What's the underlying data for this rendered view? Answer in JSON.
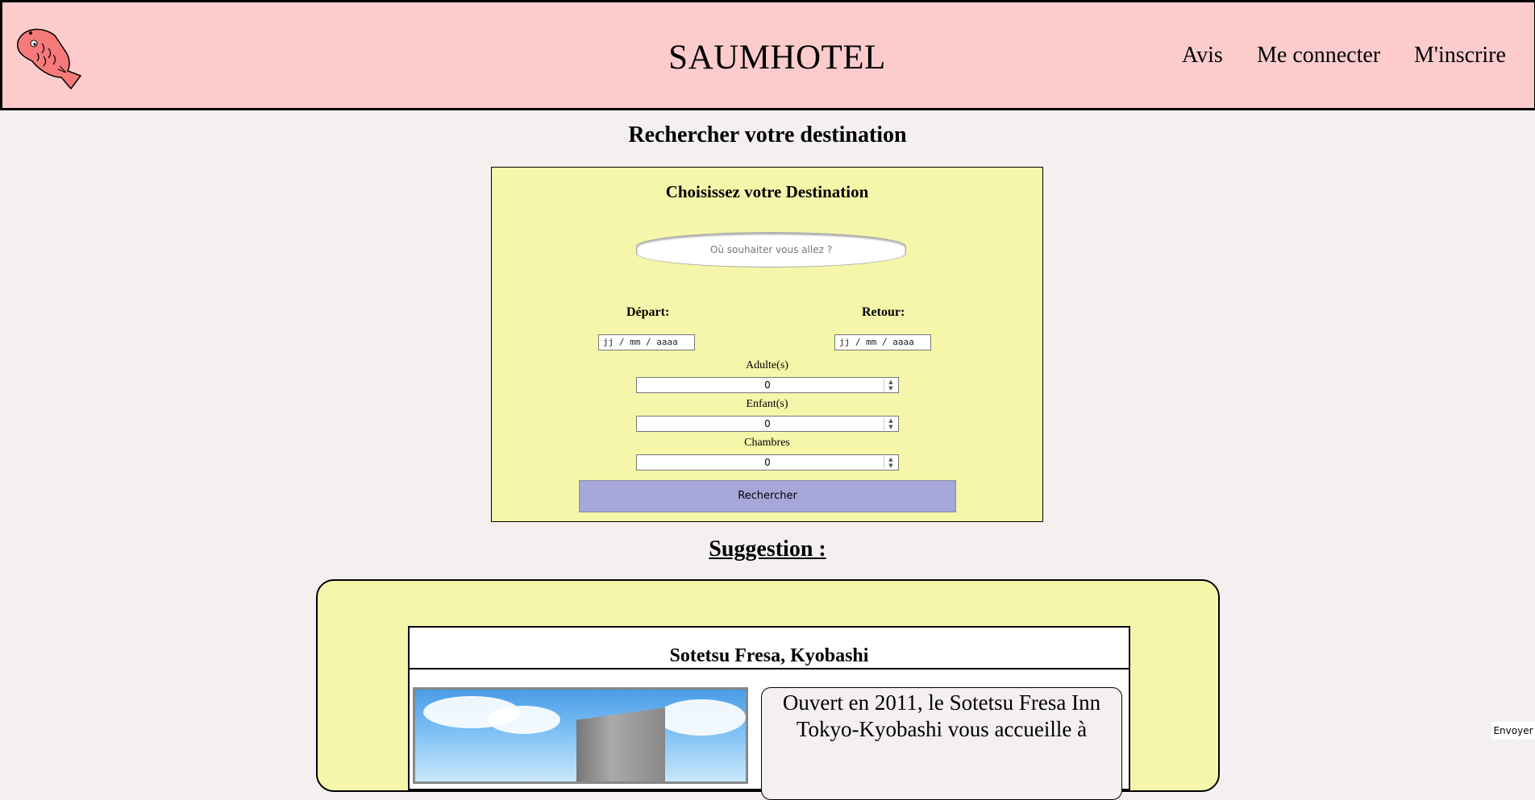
{
  "header": {
    "site_title": "SAUMHOTEL",
    "nav": {
      "avis": "Avis",
      "login": "Me connecter",
      "signup": "M'inscrire"
    },
    "logo_icon": "fish-logo-icon"
  },
  "search": {
    "page_heading": "Rechercher votre destination",
    "title": "Choisissez votre Destination",
    "destination_placeholder": "Où souhaiter vous allez ?",
    "depart_label": "Départ:",
    "retour_label": "Retour:",
    "depart_placeholder": "jj / mm / aaaa",
    "retour_placeholder": "jj / mm / aaaa",
    "adults_label": "Adulte(s)",
    "adults_value": "0",
    "children_label": "Enfant(s)",
    "children_value": "0",
    "rooms_label": "Chambres",
    "rooms_value": "0",
    "submit_label": "Rechercher"
  },
  "suggestion": {
    "heading": "Suggestion :",
    "hotel_name": "Sotetsu Fresa, Kyobashi",
    "hotel_description": "Ouvert en 2011, le Sotetsu Fresa Inn Tokyo-Kyobashi vous accueille à"
  },
  "send_label": "Envoyer",
  "colors": {
    "header_bg": "#fccccc",
    "panel_bg": "#f6f6ab",
    "button_bg": "#a6a6d9",
    "page_bg": "#f4f0f0"
  }
}
